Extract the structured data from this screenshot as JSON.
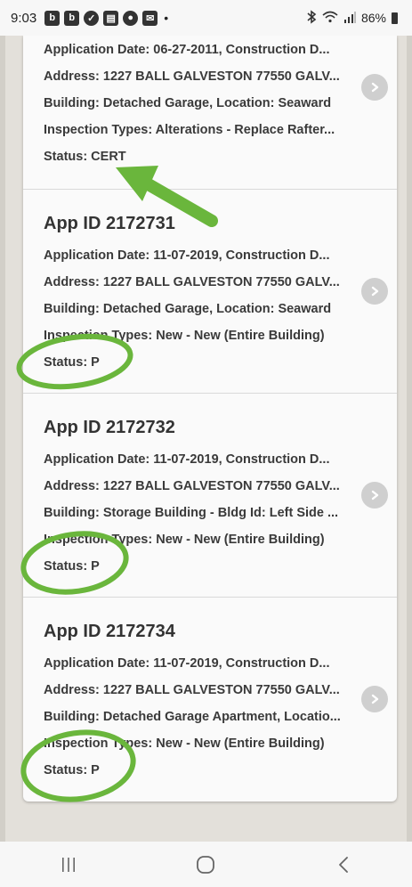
{
  "status_bar": {
    "time": "9:03",
    "battery": "86%"
  },
  "cards": [
    {
      "app_id": "",
      "application_date": "Application Date: 06-27-2011, Construction D...",
      "address": "Address: 1227 BALL GALVESTON 77550 GALV...",
      "building": "Building: Detached Garage, Location: Seaward",
      "inspection_types": "Inspection Types: Alterations - Replace Rafter...",
      "status": "Status: CERT"
    },
    {
      "app_id": "App ID 2172731",
      "application_date": "Application Date: 11-07-2019, Construction D...",
      "address": "Address: 1227 BALL GALVESTON 77550 GALV...",
      "building": "Building: Detached Garage, Location: Seaward",
      "inspection_types": "Inspection Types: New - New (Entire Building)",
      "status": "Status: P"
    },
    {
      "app_id": "App ID 2172732",
      "application_date": "Application Date: 11-07-2019, Construction D...",
      "address": "Address: 1227 BALL GALVESTON 77550 GALV...",
      "building": "Building: Storage Building - Bldg Id: Left Side ...",
      "inspection_types": "Inspection Types: New - New (Entire Building)",
      "status": "Status: P"
    },
    {
      "app_id": "App ID 2172734",
      "application_date": "Application Date: 11-07-2019, Construction D...",
      "address": "Address: 1227 BALL GALVESTON 77550 GALV...",
      "building": "Building: Detached Garage Apartment, Locatio...",
      "inspection_types": "Inspection Types: New - New (Entire Building)",
      "status": "Status: P"
    }
  ],
  "icons": {
    "card_chevron": "chevron-right-icon",
    "nav_recents": "recent-apps-icon",
    "nav_home": "home-icon",
    "nav_back": "back-icon"
  },
  "colors": {
    "annotation_green": "#6ab63c",
    "page_background": "#e3e0da",
    "card_background": "#fafafa"
  }
}
